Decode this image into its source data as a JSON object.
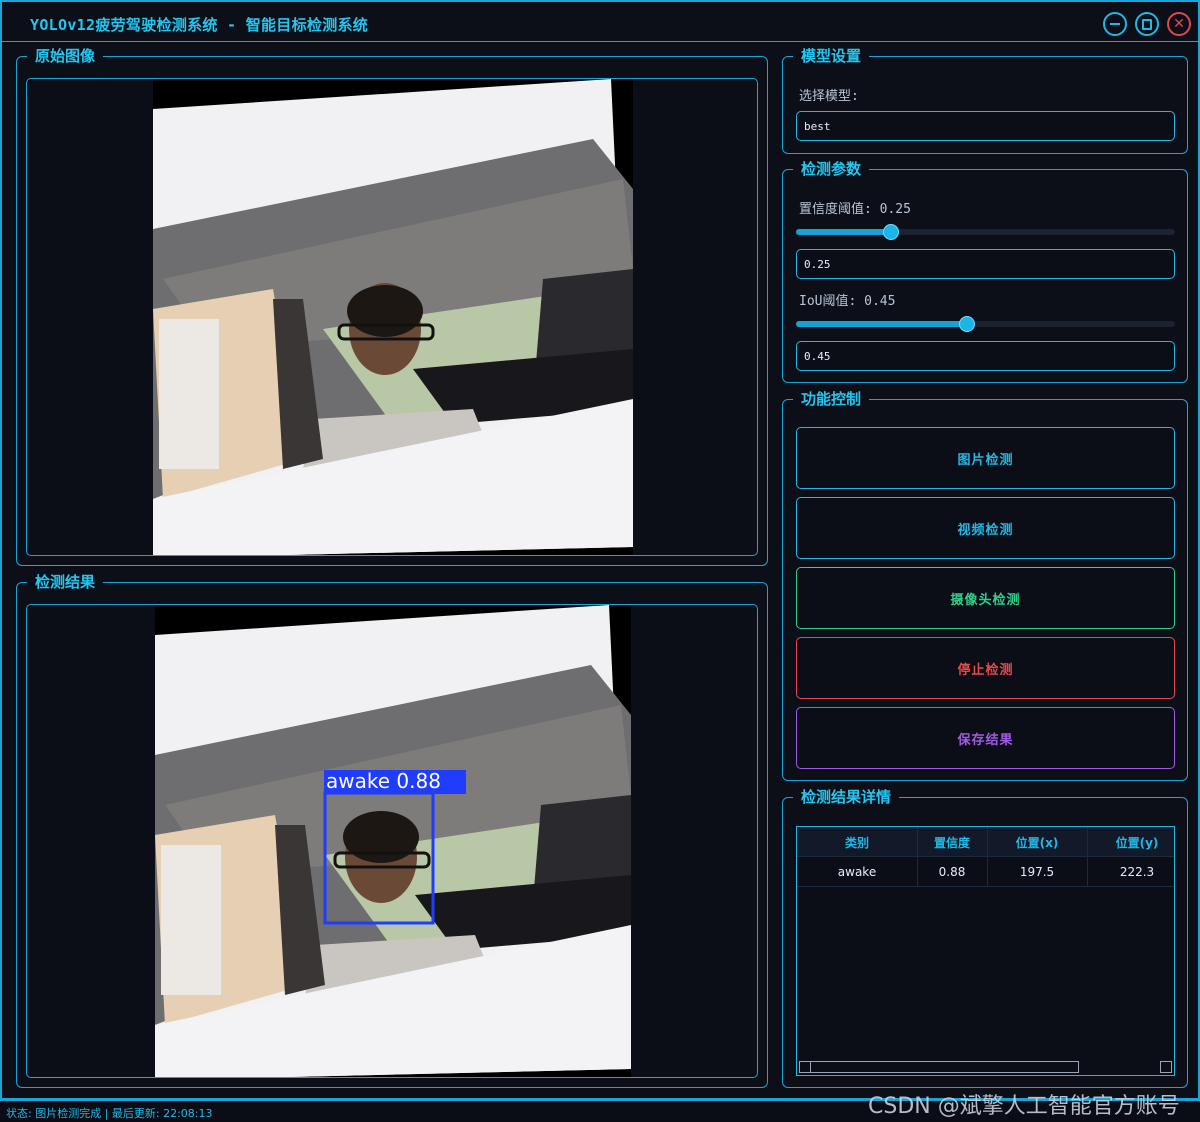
{
  "window": {
    "title": "YOLOv12疲劳驾驶检测系统 - 智能目标检测系统",
    "controls": [
      "minimize-icon",
      "maximize-icon",
      "close-icon"
    ],
    "accent_color": "#18a6d8"
  },
  "original_panel": {
    "title": "原始图像"
  },
  "result_panel": {
    "title": "检测结果",
    "detection_label": "awake 0.88",
    "box_color": "#1f3cff"
  },
  "model_settings": {
    "title": "模型设置",
    "select_label": "选择模型:",
    "selected_model": "best"
  },
  "detect_params": {
    "title": "检测参数",
    "conf_label": "置信度阈值: 0.25",
    "conf_value": "0.25",
    "conf_slider_value": 0.25,
    "iou_label": "IoU阈值: 0.45",
    "iou_value": "0.45",
    "iou_slider_value": 0.45
  },
  "controls": {
    "title": "功能控制",
    "image_detect": "图片检测",
    "video_detect": "视频检测",
    "camera_detect": "摄像头检测",
    "stop_detect": "停止检测",
    "save_result": "保存结果",
    "colors": {
      "image": "#22b8e6",
      "video": "#22b8e6",
      "camera": "#2ed08a",
      "stop": "#e84a4a",
      "save": "#a05ae6"
    }
  },
  "details": {
    "title": "检测结果详情",
    "columns": [
      "类别",
      "置信度",
      "位置(x)",
      "位置(y)"
    ],
    "rows": [
      [
        "awake",
        "0.88",
        "197.5",
        "222.3"
      ]
    ]
  },
  "status": {
    "text": "状态: 图片检测完成 | 最后更新: 22:08:13"
  },
  "watermark": "CSDN @斌擎人工智能官方账号"
}
